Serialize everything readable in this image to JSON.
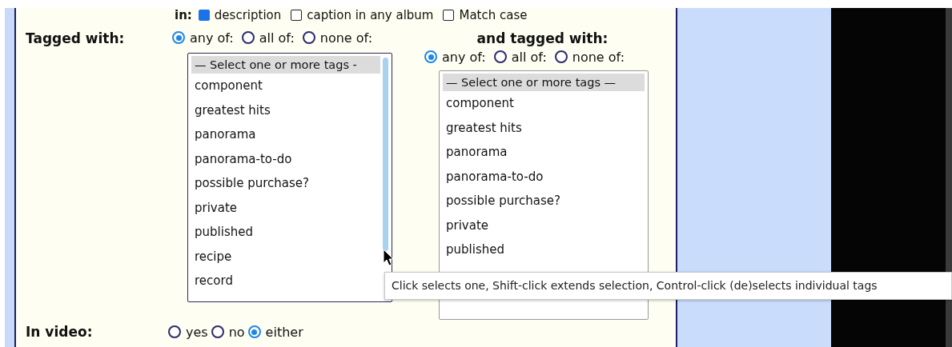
{
  "search_in": {
    "label": "in:",
    "options": [
      {
        "label": "description",
        "checked": true
      },
      {
        "label": "caption in any album",
        "checked": false
      },
      {
        "label": "Match case",
        "checked": false
      }
    ]
  },
  "tag_filter_1": {
    "label": "Tagged with:",
    "modes": [
      {
        "label": "any of:",
        "selected": true
      },
      {
        "label": "all of:",
        "selected": false
      },
      {
        "label": "none of:",
        "selected": false
      }
    ],
    "listbox": {
      "header": "— Select one or more tags -",
      "items": [
        "component",
        "greatest hits",
        "panorama",
        "panorama-to-do",
        "possible purchase?",
        "private",
        "published",
        "recipe",
        "record"
      ]
    }
  },
  "tag_filter_2": {
    "label": "and tagged with:",
    "modes": [
      {
        "label": "any of:",
        "selected": true
      },
      {
        "label": "all of:",
        "selected": false
      },
      {
        "label": "none of:",
        "selected": false
      }
    ],
    "listbox": {
      "header": "— Select one or more tags —",
      "items": [
        "component",
        "greatest hits",
        "panorama",
        "panorama-to-do",
        "possible purchase?",
        "private",
        "published"
      ]
    }
  },
  "tooltip": "Click selects one, Shift-click extends selection, Control-click (de)selects individual tags",
  "in_video": {
    "label": "In video:",
    "options": [
      {
        "label": "yes",
        "selected": false
      },
      {
        "label": "no",
        "selected": false
      },
      {
        "label": "either",
        "selected": true
      }
    ]
  }
}
